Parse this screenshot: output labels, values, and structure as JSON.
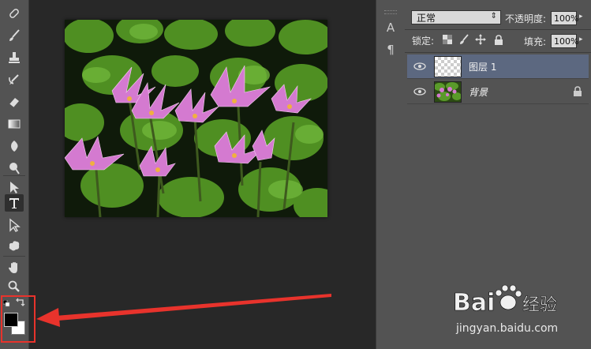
{
  "layers_panel": {
    "blend_mode": "正常",
    "opacity_label": "不透明度:",
    "opacity_value": "100%",
    "lock_label": "锁定:",
    "fill_label": "填充:",
    "fill_value": "100%",
    "layers": [
      {
        "name": "图层 1",
        "selected": true,
        "thumbnail": "transparent"
      },
      {
        "name": "背景",
        "selected": false,
        "thumbnail": "photo",
        "locked": true
      }
    ]
  },
  "toolbar": {
    "active_tool": "type-tool",
    "foreground_color": "#000000",
    "background_color": "#ffffff"
  },
  "dock": {
    "icons": [
      "character-panel-icon",
      "paragraph-panel-icon"
    ],
    "character_glyph": "A",
    "paragraph_glyph": "¶"
  },
  "colors": {
    "highlight": "#e8332c",
    "selection": "#5c6880",
    "panel": "#535353"
  },
  "watermark": {
    "brand": "Bai",
    "brand_suffix": "经验",
    "url": "jingyan.baidu.com"
  }
}
